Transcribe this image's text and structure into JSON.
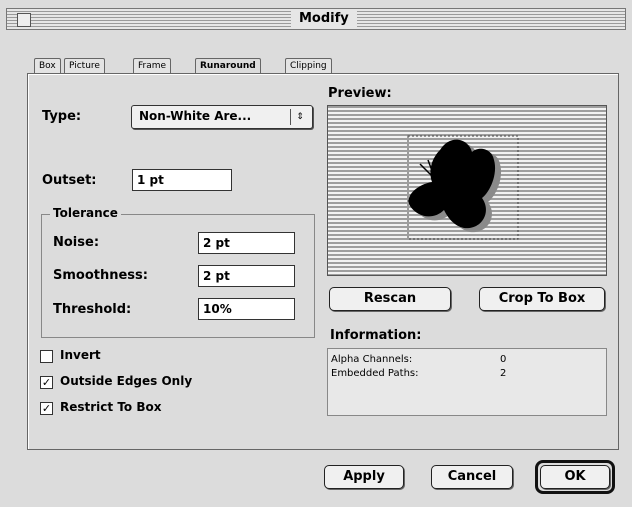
{
  "window": {
    "title": "Modify"
  },
  "tabs": [
    {
      "label": "Box"
    },
    {
      "label": "Picture"
    },
    {
      "label": "Frame"
    },
    {
      "label": "Runaround"
    },
    {
      "label": "Clipping"
    }
  ],
  "type": {
    "label": "Type:",
    "value": "Non-White Are...",
    "arrow": "⇕"
  },
  "outset": {
    "label": "Outset:",
    "value": "1 pt"
  },
  "tolerance": {
    "title": "Tolerance",
    "noise": {
      "label": "Noise:",
      "value": "2 pt"
    },
    "smoothness": {
      "label": "Smoothness:",
      "value": "2 pt"
    },
    "threshold": {
      "label": "Threshold:",
      "value": "10%"
    }
  },
  "options": {
    "invert": {
      "label": "Invert",
      "checked": false
    },
    "outside_edges": {
      "label": "Outside Edges Only",
      "checked": true
    },
    "restrict": {
      "label": "Restrict To Box",
      "checked": true
    }
  },
  "preview": {
    "label": "Preview:"
  },
  "buttons": {
    "rescan": "Rescan",
    "crop": "Crop To Box",
    "apply": "Apply",
    "cancel": "Cancel",
    "ok": "OK"
  },
  "information": {
    "label": "Information:",
    "rows": [
      {
        "key": "Alpha Channels:",
        "value": "0"
      },
      {
        "key": "Embedded Paths:",
        "value": "2"
      }
    ]
  },
  "checkmark": "✓"
}
